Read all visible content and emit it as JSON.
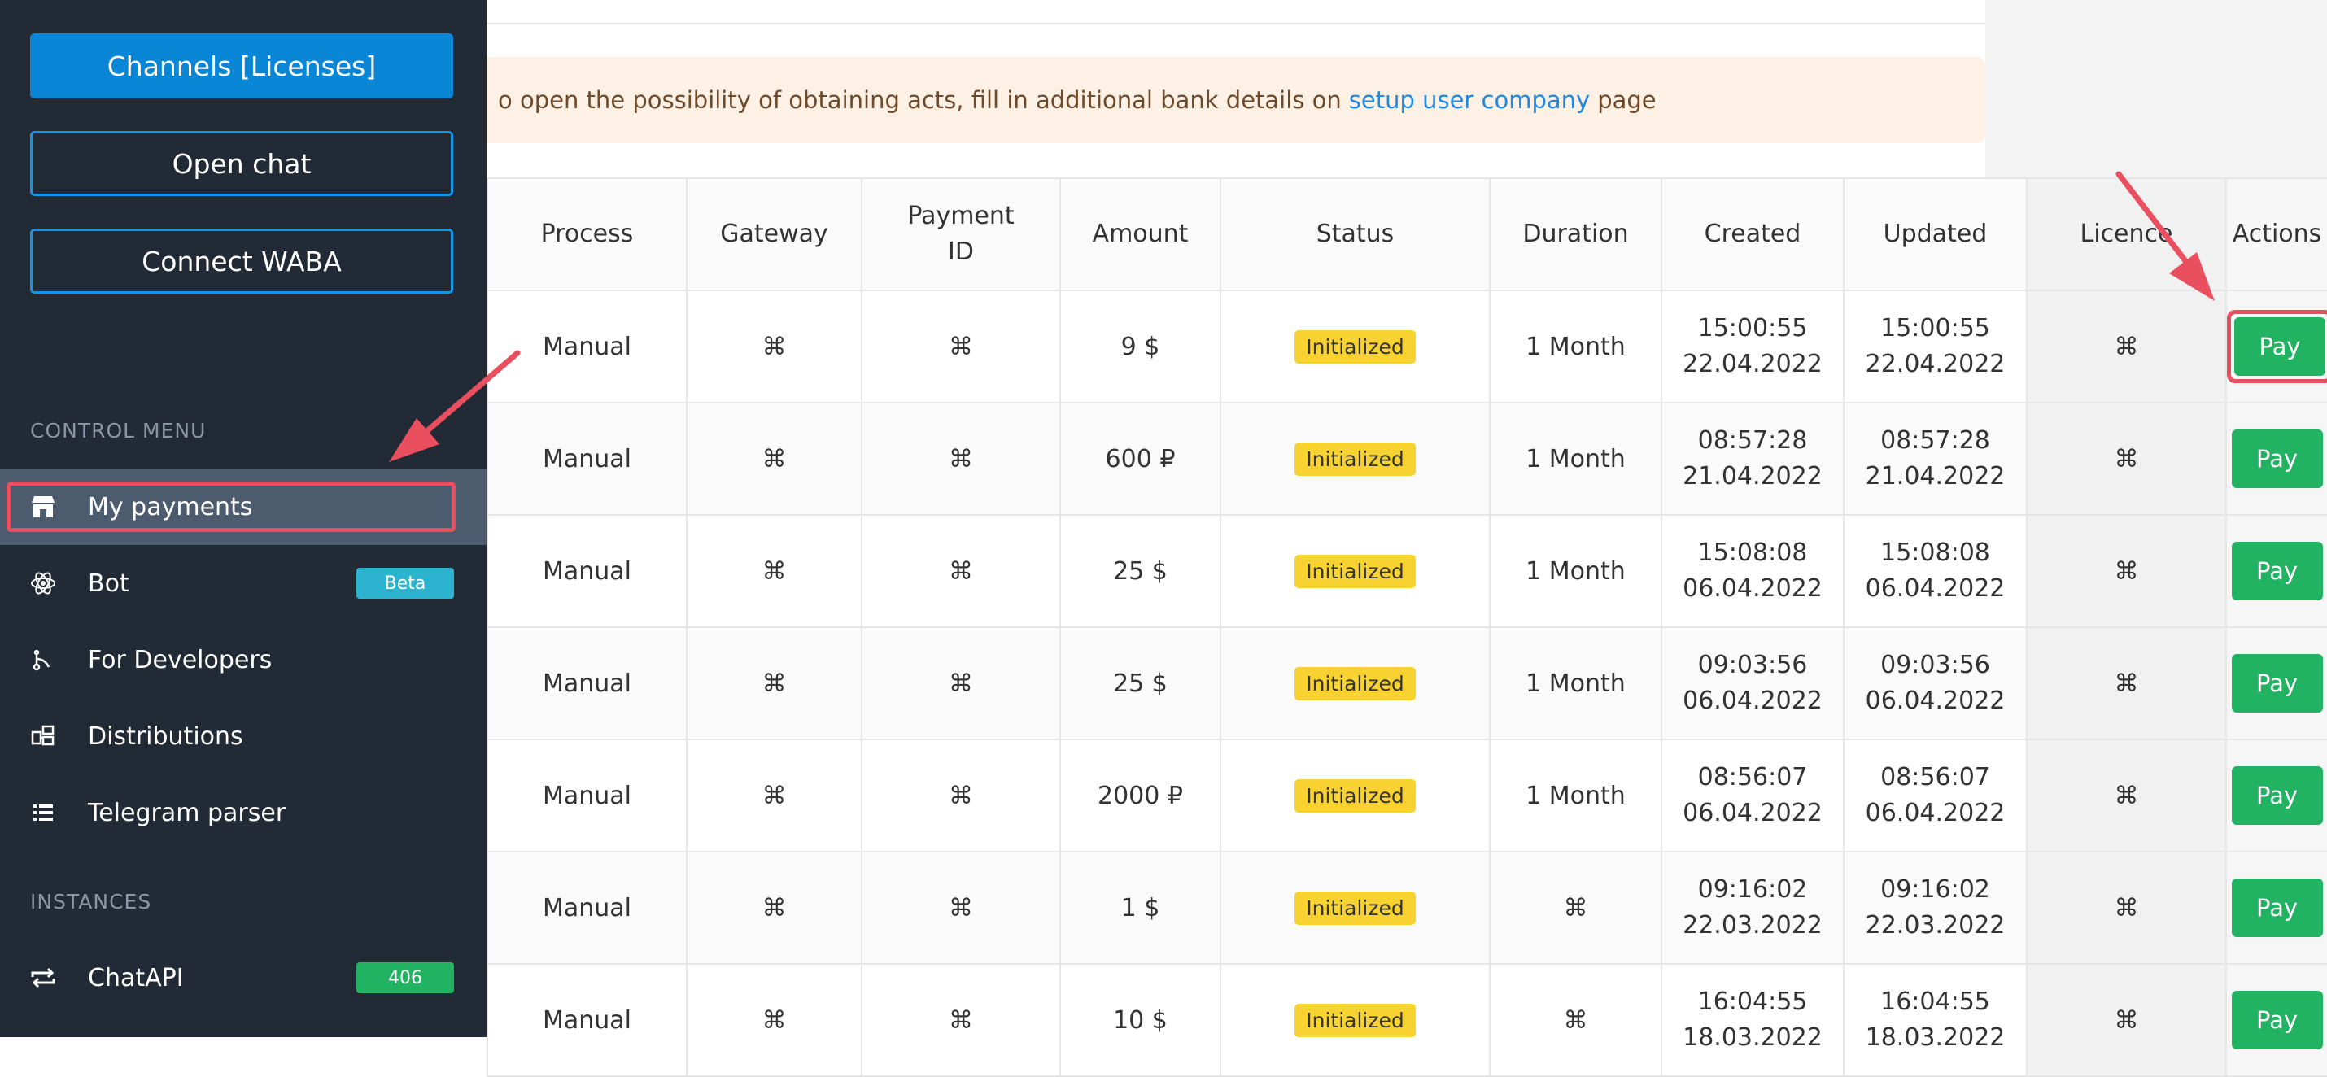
{
  "sidebar": {
    "channels_button": "Channels [Licenses]",
    "open_chat_button": "Open chat",
    "connect_waba_button": "Connect WABA",
    "control_menu_label": "CONTROL MENU",
    "instances_label": "INSTANCES",
    "items": [
      {
        "label": "My payments",
        "icon": "store-icon",
        "active": true
      },
      {
        "label": "Bot",
        "icon": "atom-icon",
        "badge": "Beta",
        "badge_color": "#2bb3cf"
      },
      {
        "label": "For Developers",
        "icon": "branch-icon"
      },
      {
        "label": "Distributions",
        "icon": "distribution-icon"
      },
      {
        "label": "Telegram parser",
        "icon": "list-icon"
      }
    ],
    "instances": [
      {
        "label": "ChatAPI",
        "icon": "repeat-icon",
        "badge": "406",
        "badge_color": "#21b262"
      }
    ]
  },
  "notice": {
    "text_before": "o open the possibility of obtaining acts, fill in additional bank details on",
    "link_text": "setup user company",
    "text_after": "page"
  },
  "table": {
    "columns": [
      "Process",
      "Gateway",
      "Payment ID",
      "Amount",
      "Status",
      "Duration",
      "Created",
      "Updated",
      "Licence",
      "Actions"
    ],
    "column_lines": {
      "payment_id": [
        "Payment",
        "ID"
      ]
    },
    "rows": [
      {
        "process": "Manual",
        "gateway": "⌘",
        "payment_id": "⌘",
        "amount": "9 $",
        "status": "Initialized",
        "duration": "1 Month",
        "created_time": "15:00:55",
        "created_date": "22.04.2022",
        "updated_time": "15:00:55",
        "updated_date": "22.04.2022",
        "licence": "⌘",
        "action": "Pay"
      },
      {
        "process": "Manual",
        "gateway": "⌘",
        "payment_id": "⌘",
        "amount": "600 ₽",
        "status": "Initialized",
        "duration": "1 Month",
        "created_time": "08:57:28",
        "created_date": "21.04.2022",
        "updated_time": "08:57:28",
        "updated_date": "21.04.2022",
        "licence": "⌘",
        "action": "Pay"
      },
      {
        "process": "Manual",
        "gateway": "⌘",
        "payment_id": "⌘",
        "amount": "25 $",
        "status": "Initialized",
        "duration": "1 Month",
        "created_time": "15:08:08",
        "created_date": "06.04.2022",
        "updated_time": "15:08:08",
        "updated_date": "06.04.2022",
        "licence": "⌘",
        "action": "Pay"
      },
      {
        "process": "Manual",
        "gateway": "⌘",
        "payment_id": "⌘",
        "amount": "25 $",
        "status": "Initialized",
        "duration": "1 Month",
        "created_time": "09:03:56",
        "created_date": "06.04.2022",
        "updated_time": "09:03:56",
        "updated_date": "06.04.2022",
        "licence": "⌘",
        "action": "Pay"
      },
      {
        "process": "Manual",
        "gateway": "⌘",
        "payment_id": "⌘",
        "amount": "2000 ₽",
        "status": "Initialized",
        "duration": "1 Month",
        "created_time": "08:56:07",
        "created_date": "06.04.2022",
        "updated_time": "08:56:07",
        "updated_date": "06.04.2022",
        "licence": "⌘",
        "action": "Pay"
      },
      {
        "process": "Manual",
        "gateway": "⌘",
        "payment_id": "⌘",
        "amount": "1 $",
        "status": "Initialized",
        "duration": "⌘",
        "created_time": "09:16:02",
        "created_date": "22.03.2022",
        "updated_time": "09:16:02",
        "updated_date": "22.03.2022",
        "licence": "⌘",
        "action": "Pay"
      },
      {
        "process": "Manual",
        "gateway": "⌘",
        "payment_id": "⌘",
        "amount": "10 $",
        "status": "Initialized",
        "duration": "⌘",
        "created_time": "16:04:55",
        "created_date": "18.03.2022",
        "updated_time": "16:04:55",
        "updated_date": "18.03.2022",
        "licence": "⌘",
        "action": "Pay"
      }
    ]
  },
  "colors": {
    "sidebar_bg": "#222a36",
    "primary": "#0a86d6",
    "pay_green": "#21b262",
    "badge_yellow": "#f8d231",
    "annotation_red": "#e94f5f"
  }
}
